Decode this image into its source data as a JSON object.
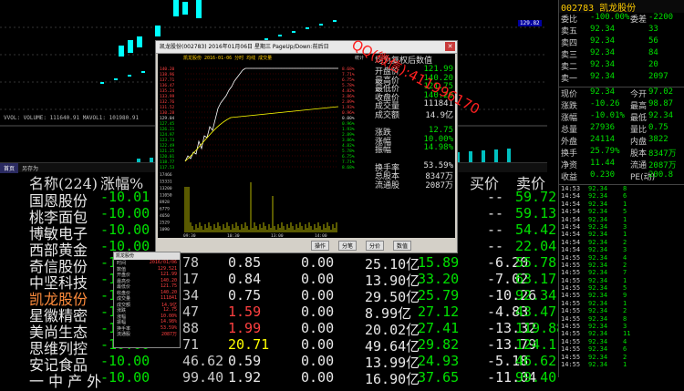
{
  "kline": {
    "vol_line": "VVOL: VOLUME: 111640.91  MAVOL1: 101980.91",
    "price_tag": "129.82"
  },
  "tabs": [
    "首页",
    "另存为"
  ],
  "table": {
    "headers": {
      "name": "名称(224)",
      "pct": "涨幅%",
      "bid": "买价",
      "ask": "卖价"
    },
    "rows": [
      {
        "name": "国恩股份",
        "pct": "-10.01",
        "c3": "",
        "c4": "",
        "c5": "",
        "c6": "",
        "c7": "",
        "c8": "--",
        "c9": "59.72",
        "hl": false
      },
      {
        "name": "桃李面包",
        "pct": "-10.00",
        "c3": "",
        "c4": "",
        "c5": "",
        "c6": "",
        "c7": "",
        "c8": "--",
        "c9": "59.13",
        "hl": false
      },
      {
        "name": "博敏电子",
        "pct": "-10.00",
        "c3": "",
        "c4": "",
        "c5": "",
        "c6": "",
        "c7": "",
        "c8": "--",
        "c9": "54.42",
        "hl": false
      },
      {
        "name": "西部黄金",
        "pct": "-10.00",
        "c3": "",
        "c4": "",
        "c5": "",
        "c6": "",
        "c7": "",
        "c8": "--",
        "c9": "22.04",
        "hl": false
      },
      {
        "name": "奇信股份",
        "pct": "-10.01",
        "c3": "78",
        "c4": "0.85",
        "c5": "0.00",
        "c6": "25.10亿",
        "c7": "15.89",
        "c8": "-6.20",
        "c9": "55.78",
        "hl": false
      },
      {
        "name": "中坚科技",
        "pct": "-10.01",
        "c3": "17",
        "c4": "0.84",
        "c5": "0.00",
        "c6": "13.90亿",
        "c7": "33.20",
        "c8": "-7.02",
        "c9": "63.17",
        "hl": false
      },
      {
        "name": "凯龙股份",
        "pct": "-10.01",
        "c3": "34",
        "c4": "0.75",
        "c5": "0.00",
        "c6": "29.50亿",
        "c7": "25.79",
        "c8": "-10.26",
        "c9": "92.34",
        "hl": true
      },
      {
        "name": "星徽精密",
        "pct": "-10.01",
        "c3": "47",
        "c4": "1.59",
        "c5": "0.00",
        "c6": "8.99亿",
        "c7": "27.12",
        "c8": "-4.83",
        "c9": "43.47",
        "hl": false
      },
      {
        "name": "美尚生态",
        "pct": "-10.00",
        "c3": "88",
        "c4": "1.99",
        "c5": "0.00",
        "c6": "20.02亿",
        "c7": "27.41",
        "c8": "-13.32",
        "c9": "119.88",
        "hl": false
      },
      {
        "name": "思维列控",
        "pct": "-10.00",
        "c3": "71",
        "c4": "20.71",
        "c5": "0.00",
        "c6": "49.64亿",
        "c7": "29.82",
        "c8": "-13.79",
        "c9": "124.11",
        "hl": false
      },
      {
        "name": "安记食品",
        "pct": "-10.00",
        "c3": "46.62",
        "c4": "0.59",
        "c5": "0.00",
        "c6": "13.99亿",
        "c7": "24.93",
        "c8": "-5.18",
        "c9": "46.62",
        "hl": false
      },
      {
        "name": "一 中 产 外",
        "pct": "-10.00",
        "c3": "99.40",
        "c4": "1.92",
        "c5": "0.00",
        "c6": "16.90亿",
        "c7": "37.65",
        "c8": "-11.04",
        "c9": "99.40",
        "hl": false
      }
    ]
  },
  "right": {
    "title": "002783  凯龙股份",
    "top_rows": [
      {
        "l": "委比",
        "v": "-100.00%",
        "l2": "委差",
        "v2": "-2200"
      },
      {
        "l": "卖五",
        "v": "92.34",
        "l2": "",
        "v2": "33"
      },
      {
        "l": "卖四",
        "v": "92.34",
        "l2": "",
        "v2": "56"
      },
      {
        "l": "卖三",
        "v": "92.34",
        "l2": "",
        "v2": "84"
      },
      {
        "l": "卖二",
        "v": "92.34",
        "l2": "",
        "v2": "20"
      },
      {
        "l": "卖一",
        "v": "92.34",
        "l2": "",
        "v2": "2097"
      }
    ],
    "quote_rows": [
      {
        "l": "现价",
        "v": "92.34",
        "l2": "今开",
        "v2": "97.02"
      },
      {
        "l": "涨跌",
        "v": "-10.26",
        "l2": "最高",
        "v2": "98.87"
      },
      {
        "l": "涨幅",
        "v": "-10.01%",
        "l2": "最低",
        "v2": "92.34"
      },
      {
        "l": "总量",
        "v": "27936",
        "l2": "量比",
        "v2": "0.75"
      },
      {
        "l": "外盘",
        "v": "24114",
        "l2": "内盘",
        "v2": "3822"
      },
      {
        "l": "换手",
        "v": "25.79%",
        "l2": "股本",
        "v2": "8347万"
      },
      {
        "l": "净资",
        "v": "11.44",
        "l2": "流通",
        "v2": "2087万"
      },
      {
        "l": "收益",
        "v": "0.230",
        "l2": "PE(动)",
        "v2": "200.8"
      }
    ],
    "ticks": [
      [
        "14:53",
        "92.34",
        "8"
      ],
      [
        "14:54",
        "92.34",
        "6"
      ],
      [
        "14:54",
        "92.34",
        "1"
      ],
      [
        "14:54",
        "92.34",
        "5"
      ],
      [
        "14:54",
        "92.34",
        "1"
      ],
      [
        "14:54",
        "92.34",
        "3"
      ],
      [
        "14:54",
        "92.34",
        "1"
      ],
      [
        "14:54",
        "92.34",
        "2"
      ],
      [
        "14:54",
        "92.34",
        "3"
      ],
      [
        "14:55",
        "92.34",
        "4"
      ],
      [
        "14:55",
        "92.34",
        "2"
      ],
      [
        "14:55",
        "92.34",
        "7"
      ],
      [
        "14:55",
        "92.34",
        "1"
      ],
      [
        "14:55",
        "92.34",
        "5"
      ],
      [
        "14:55",
        "92.34",
        "9"
      ],
      [
        "14:55",
        "92.34",
        "1"
      ],
      [
        "14:55",
        "92.34",
        "2"
      ],
      [
        "14:55",
        "92.34",
        "8"
      ],
      [
        "14:55",
        "92.34",
        "3"
      ],
      [
        "14:55",
        "92.34",
        "11"
      ],
      [
        "14:55",
        "92.34",
        "4"
      ],
      [
        "14:55",
        "92.34",
        "6"
      ],
      [
        "14:55",
        "92.34",
        "2"
      ],
      [
        "14:55",
        "92.34",
        "1"
      ]
    ]
  },
  "popup": {
    "title": "凯龙股份(002783) 2016年01月06日 星期三 PageUp/Down:前后日",
    "chart_header": "凯龙股份  2016-01-06  分时  均线  成交量",
    "chart_tab": "统计",
    "y_left": [
      "140.20",
      "138.96",
      "137.71",
      "136.47",
      "135.24",
      "133.99",
      "132.76",
      "131.52",
      "130.28",
      "129.04",
      "127.45",
      "126.21",
      "124.97",
      "123.73",
      "122.49",
      "121.25",
      "120.01",
      "118.77",
      "117.53"
    ],
    "y_right": [
      "8.68%",
      "7.71%",
      "6.75%",
      "5.78%",
      "4.82%",
      "3.86%",
      "2.89%",
      "1.93%",
      "0.96%",
      "0.00%",
      "0.96%",
      "1.93%",
      "2.89%",
      "3.86%",
      "4.82%",
      "5.78%",
      "6.75%",
      "7.71%",
      "8.68%"
    ],
    "vol_labels": [
      "17466",
      "15331",
      "13200",
      "11050",
      "8928",
      "6779",
      "4650",
      "2529",
      "1090"
    ],
    "x_labels": [
      "09:30",
      "10:30",
      "13:00",
      "14:00"
    ],
    "info_header": "均为复权后数值",
    "info_rows": [
      {
        "l": "开盘价",
        "v": "121.99",
        "w": false
      },
      {
        "l": "最高价",
        "v": "140.20",
        "w": false
      },
      {
        "l": "最低价",
        "v": "121.75",
        "w": false
      },
      {
        "l": "收盘价",
        "v": "140.20",
        "w": false
      },
      {
        "l": "成交量",
        "v": "111841",
        "w": true
      },
      {
        "l": "成交额",
        "v": "14.9亿",
        "w": true
      },
      {
        "l": "",
        "v": "",
        "w": true
      },
      {
        "l": "涨跌",
        "v": "12.75",
        "w": false
      },
      {
        "l": "涨幅",
        "v": "10.00%",
        "w": false
      },
      {
        "l": "振幅",
        "v": "14.98%",
        "w": false
      },
      {
        "l": "",
        "v": "",
        "w": true
      },
      {
        "l": "换手率",
        "v": "53.59%",
        "w": true
      },
      {
        "l": "总股本",
        "v": "8347万",
        "w": true
      },
      {
        "l": "流通股",
        "v": "2087万",
        "w": true
      }
    ],
    "buttons": [
      "操作",
      "分笔",
      "分价",
      "数值"
    ]
  },
  "mini": {
    "title": "凯龙股份",
    "rows": [
      [
        "时间",
        "2016/01/06"
      ],
      [
        "数值",
        "129.521"
      ],
      [
        "开盘价",
        "121.99"
      ],
      [
        "最高价",
        "140.20"
      ],
      [
        "最低价",
        "121.75"
      ],
      [
        "收盘价",
        "140.20"
      ],
      [
        "成交量",
        "111841"
      ],
      [
        "成交额",
        "14.9亿"
      ],
      [
        "涨跌",
        "12.75"
      ],
      [
        "涨幅",
        "10.00%"
      ],
      [
        "振幅",
        "14.98%"
      ],
      [
        "换手率",
        "53.59%"
      ],
      [
        "流通股",
        "2087万"
      ]
    ]
  },
  "watermark": "QQ(微信):411996170",
  "colors": {
    "up": "#ff4040",
    "down": "#00e000",
    "bg": "#000000",
    "highlight": "#ff8c3c"
  }
}
